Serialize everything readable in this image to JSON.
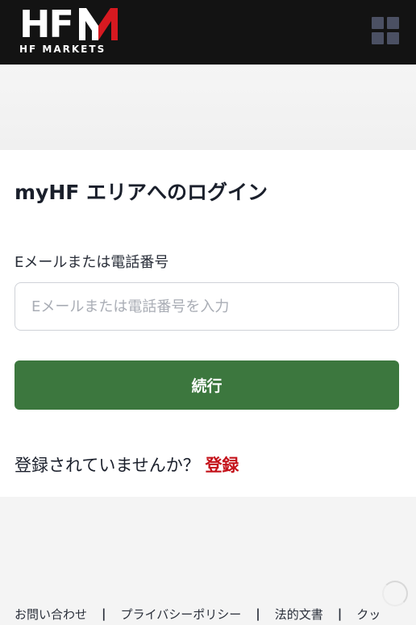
{
  "header": {
    "logo_letters_h": "H",
    "logo_letters_f": "F",
    "logo_subtitle": "HF MARKETS",
    "menu_icon": "grid-menu-icon",
    "brand_red": "#d71920"
  },
  "login": {
    "title": "myHF エリアへのログイン",
    "field_label": "Eメールまたは電話番号",
    "field_placeholder": "Eメールまたは電話番号を入力",
    "field_value": "",
    "continue_label": "続行",
    "continue_color": "#3c773e",
    "register_prompt": "登録されていませんか？",
    "register_link": "登録",
    "register_color": "#c4121a"
  },
  "footer": {
    "links": [
      "お問い合わせ",
      "プライバシーポリシー",
      "法的文書",
      "クッ"
    ],
    "separator": "|"
  }
}
